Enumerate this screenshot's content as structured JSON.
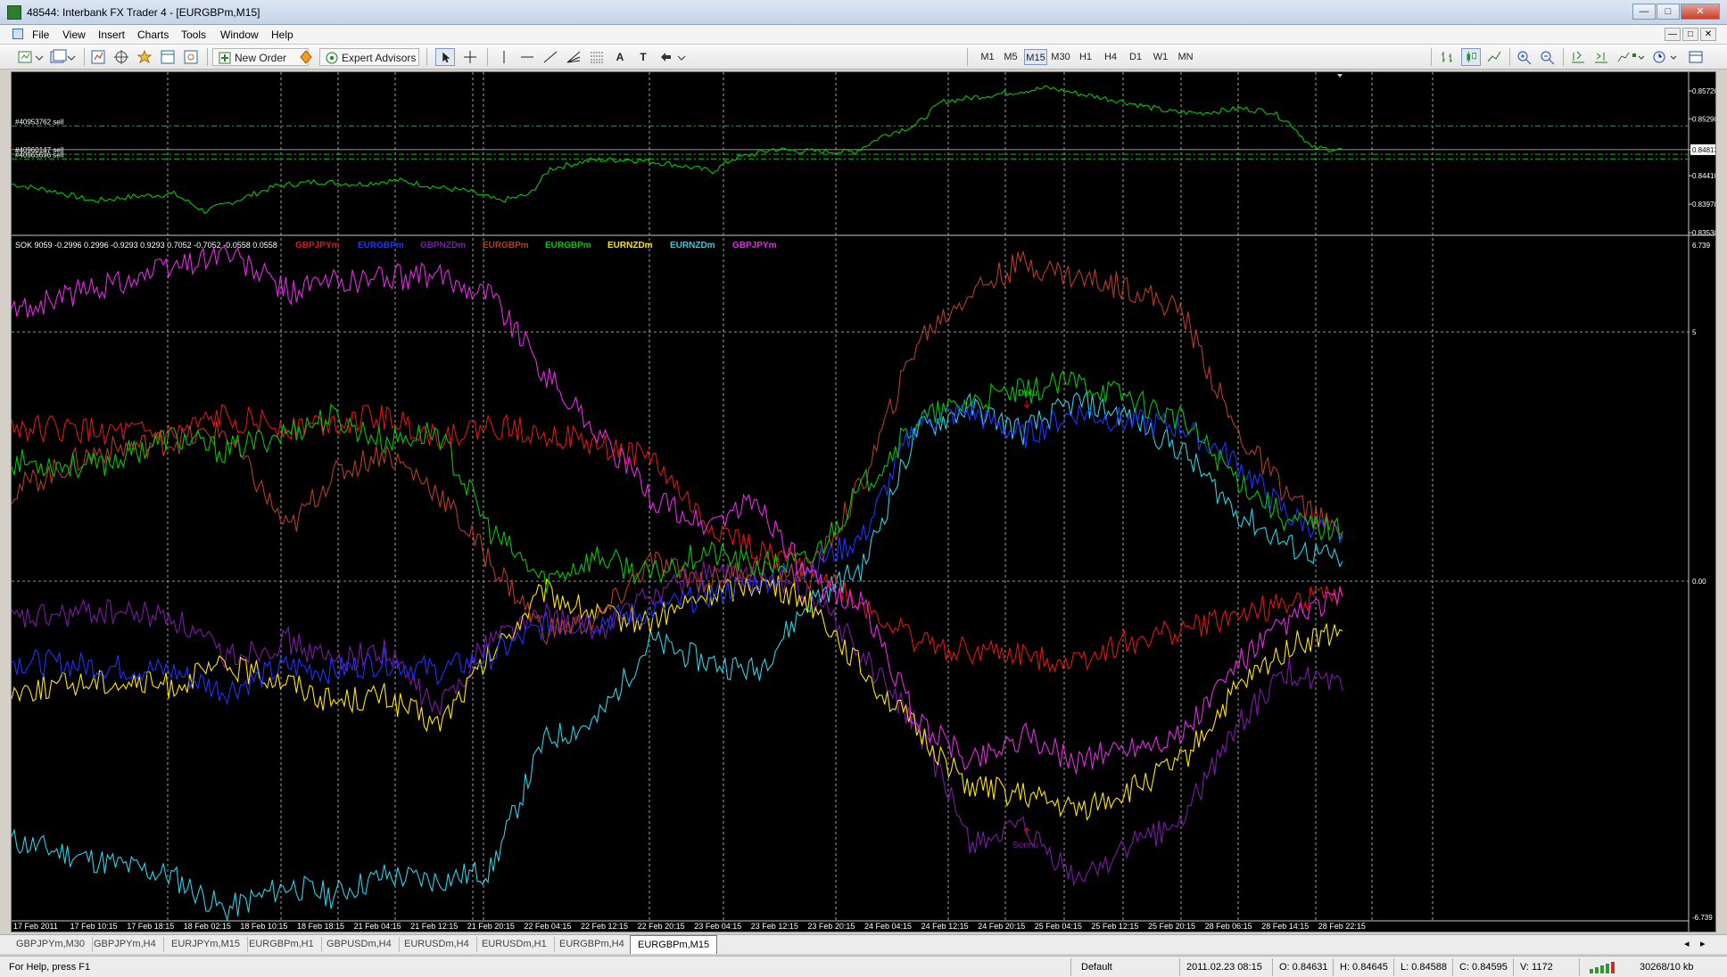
{
  "window": {
    "title": "48544: Interbank FX Trader 4 - [EURGBPm,M15]",
    "min_label": "—",
    "max_label": "□",
    "close_label": "✕"
  },
  "menu": {
    "items": [
      "File",
      "View",
      "Insert",
      "Charts",
      "Tools",
      "Window",
      "Help"
    ]
  },
  "toolbar": {
    "new_order_label": "New Order",
    "expert_advisors_label": "Expert Advisors",
    "timeframes": [
      "M1",
      "M5",
      "M15",
      "M30",
      "H1",
      "H4",
      "D1",
      "W1",
      "MN"
    ],
    "active_timeframe": "M15",
    "text_tool_label": "A",
    "label_tool_label": "T"
  },
  "colors": {
    "price_line": "#00c800",
    "grid": "#c8c8c8",
    "GBPJPYm": "#e01414",
    "EURGBPm_blue": "#1e32ff",
    "GBPNZDm": "#7d18a8",
    "EURGBPm_dark": "#b43c28",
    "EURGBPm_green": "#00c800",
    "EURNZDm": "#ffe600",
    "EURNZDm_cyan": "#28d2e6",
    "GBPJPYm_magenta": "#e628e6"
  },
  "price_panel": {
    "price_axis": [
      "0.85720",
      "0.85290",
      "0.84813",
      "0.84410",
      "0.83970",
      "0.83530"
    ],
    "current_price": "0.84813",
    "orders": [
      {
        "label": "#40953762 sell",
        "price": 0.8518
      },
      {
        "label": "#40960147 sell",
        "price": 0.8474
      },
      {
        "label": "#40965696 sell",
        "price": 0.8467
      }
    ]
  },
  "indicator_panel": {
    "header": "SOK 9059 -0.2996 0.2996 -0.9293 0.9293 0.7052 -0.7052 -0.0558 0.0558",
    "legend": [
      {
        "name": "GBPJPYm",
        "color": "#e01414"
      },
      {
        "name": "EURGBPm",
        "color": "#1e32ff"
      },
      {
        "name": "GBPNZDm",
        "color": "#7d18a8"
      },
      {
        "name": "EURGBPm",
        "color": "#b43c28"
      },
      {
        "name": "EURGBPm",
        "color": "#00c800"
      },
      {
        "name": "EURNZDm",
        "color": "#ffe600"
      },
      {
        "name": "EURNZDm",
        "color": "#28d2e6"
      },
      {
        "name": "GBPJPYm",
        "color": "#e628e6"
      }
    ],
    "axis_top": "6.739",
    "axis_five": "5",
    "axis_zero": "0.00",
    "axis_bottom": "-6.739",
    "label_top": "Dolu",
    "label_bottom": "Sonnu"
  },
  "time_axis": [
    "17 Feb 2011",
    "17 Feb 10:15",
    "17 Feb 18:15",
    "18 Feb 02:15",
    "18 Feb 10:15",
    "18 Feb 18:15",
    "21 Feb 04:15",
    "21 Feb 12:15",
    "21 Feb 20:15",
    "22 Feb 04:15",
    "22 Feb 12:15",
    "22 Feb 20:15",
    "23 Feb 04:15",
    "23 Feb 12:15",
    "23 Feb 20:15",
    "24 Feb 04:15",
    "24 Feb 12:15",
    "24 Feb 20:15",
    "25 Feb 04:15",
    "25 Feb 12:15",
    "25 Feb 20:15",
    "28 Feb 06:15",
    "28 Feb 14:15",
    "28 Feb 22:15"
  ],
  "tabs": [
    "GBPJPYm,M30",
    "GBPJPYm,H4",
    "EURJPYm,M15",
    "EURGBPm,H1",
    "GBPUSDm,H4",
    "EURUSDm,H4",
    "EURUSDm,H1",
    "EURGBPm,H4",
    "EURGBPm,M15"
  ],
  "active_tab": "EURGBPm,M15",
  "status": {
    "help": "For Help, press F1",
    "profile": "Default",
    "datetime": "2011.02.23 08:15",
    "open": "O: 0.84631",
    "high": "H: 0.84645",
    "low": "L: 0.84588",
    "close": "C: 0.84595",
    "volume": "V: 1172",
    "traffic": "30268/10 kb"
  },
  "series_paths": {
    "price": [
      [
        0,
        0.8428
      ],
      [
        0.04,
        0.8418
      ],
      [
        0.08,
        0.8402
      ],
      [
        0.12,
        0.8409
      ],
      [
        0.16,
        0.8413
      ],
      [
        0.19,
        0.8386
      ],
      [
        0.22,
        0.8402
      ],
      [
        0.26,
        0.8425
      ],
      [
        0.3,
        0.8432
      ],
      [
        0.34,
        0.8428
      ],
      [
        0.38,
        0.8434
      ],
      [
        0.42,
        0.8423
      ],
      [
        0.45,
        0.8417
      ],
      [
        0.48,
        0.8402
      ],
      [
        0.51,
        0.8412
      ],
      [
        0.53,
        0.8452
      ],
      [
        0.57,
        0.8465
      ],
      [
        0.61,
        0.8466
      ],
      [
        0.65,
        0.8459
      ],
      [
        0.69,
        0.8448
      ],
      [
        0.71,
        0.8467
      ],
      [
        0.75,
        0.8482
      ],
      [
        0.78,
        0.8479
      ],
      [
        0.83,
        0.8478
      ],
      [
        0.86,
        0.8505
      ],
      [
        0.89,
        0.8519
      ],
      [
        0.915,
        0.8555
      ],
      [
        0.95,
        0.8563
      ],
      [
        0.98,
        0.8569
      ],
      [
        1.02,
        0.8577
      ],
      [
        1.05,
        0.8568
      ],
      [
        1.09,
        0.8557
      ],
      [
        1.14,
        0.854
      ],
      [
        1.17,
        0.8538
      ],
      [
        1.21,
        0.8545
      ],
      [
        1.24,
        0.854
      ],
      [
        1.26,
        0.852
      ],
      [
        1.28,
        0.8484
      ],
      [
        1.31,
        0.8481
      ]
    ],
    "GBPJPYm": [
      [
        0,
        3.1
      ],
      [
        0.08,
        3.0
      ],
      [
        0.15,
        2.9
      ],
      [
        0.2,
        3.3
      ],
      [
        0.26,
        3.1
      ],
      [
        0.3,
        3.2
      ],
      [
        0.35,
        3.3
      ],
      [
        0.4,
        2.9
      ],
      [
        0.45,
        3.1
      ],
      [
        0.5,
        3.0
      ],
      [
        0.55,
        2.7
      ],
      [
        0.6,
        2.5
      ],
      [
        0.65,
        1.2
      ],
      [
        0.7,
        0.6
      ],
      [
        0.75,
        0.3
      ],
      [
        0.8,
        -0.5
      ],
      [
        0.85,
        -1.2
      ],
      [
        0.9,
        -1.4
      ],
      [
        0.95,
        -1.5
      ],
      [
        1.0,
        -1.6
      ],
      [
        1.05,
        -1.2
      ],
      [
        1.1,
        -1.0
      ],
      [
        1.15,
        -0.7
      ],
      [
        1.2,
        -0.4
      ],
      [
        1.25,
        -0.3
      ]
    ],
    "EURGBPm_blue": [
      [
        0,
        -1.6
      ],
      [
        0.08,
        -1.7
      ],
      [
        0.15,
        -1.8
      ],
      [
        0.2,
        -2.2
      ],
      [
        0.26,
        -1.7
      ],
      [
        0.3,
        -1.8
      ],
      [
        0.35,
        -1.6
      ],
      [
        0.4,
        -1.8
      ],
      [
        0.45,
        -1.5
      ],
      [
        0.5,
        -0.9
      ],
      [
        0.55,
        -0.8
      ],
      [
        0.6,
        -0.6
      ],
      [
        0.65,
        -0.3
      ],
      [
        0.7,
        0.0
      ],
      [
        0.75,
        0.3
      ],
      [
        0.8,
        0.9
      ],
      [
        0.85,
        3.2
      ],
      [
        0.9,
        3.4
      ],
      [
        0.95,
        2.9
      ],
      [
        1.0,
        3.4
      ],
      [
        1.05,
        3.2
      ],
      [
        1.1,
        3.1
      ],
      [
        1.15,
        2.4
      ],
      [
        1.2,
        1.3
      ],
      [
        1.25,
        0.9
      ]
    ],
    "GBPNZDm": [
      [
        0,
        -0.8
      ],
      [
        0.08,
        -0.6
      ],
      [
        0.15,
        -0.7
      ],
      [
        0.2,
        -1.5
      ],
      [
        0.26,
        -1.2
      ],
      [
        0.3,
        -1.6
      ],
      [
        0.35,
        -1.4
      ],
      [
        0.4,
        -2.6
      ],
      [
        0.45,
        -1.1
      ],
      [
        0.5,
        -0.7
      ],
      [
        0.55,
        -1.0
      ],
      [
        0.6,
        -0.3
      ],
      [
        0.65,
        0.2
      ],
      [
        0.7,
        0.0
      ],
      [
        0.75,
        -0.2
      ],
      [
        0.8,
        -1.5
      ],
      [
        0.85,
        -2.9
      ],
      [
        0.9,
        -5.2
      ],
      [
        0.95,
        -5.0
      ],
      [
        1.0,
        -6.0
      ],
      [
        1.05,
        -5.3
      ],
      [
        1.1,
        -4.8
      ],
      [
        1.15,
        -2.9
      ],
      [
        1.2,
        -1.8
      ],
      [
        1.25,
        -2.2
      ]
    ],
    "EURGBPm_dark": [
      [
        0,
        1.8
      ],
      [
        0.08,
        2.6
      ],
      [
        0.15,
        2.8
      ],
      [
        0.2,
        3.0
      ],
      [
        0.26,
        1.0
      ],
      [
        0.3,
        2.1
      ],
      [
        0.35,
        2.6
      ],
      [
        0.4,
        1.8
      ],
      [
        0.45,
        0.4
      ],
      [
        0.5,
        -1.0
      ],
      [
        0.55,
        -0.8
      ],
      [
        0.6,
        0.4
      ],
      [
        0.65,
        0.0
      ],
      [
        0.7,
        0.3
      ],
      [
        0.75,
        0.1
      ],
      [
        0.8,
        2.0
      ],
      [
        0.85,
        4.8
      ],
      [
        0.9,
        5.8
      ],
      [
        0.95,
        6.4
      ],
      [
        1.0,
        6.1
      ],
      [
        1.05,
        5.9
      ],
      [
        1.1,
        5.4
      ],
      [
        1.15,
        3.0
      ],
      [
        1.2,
        1.7
      ],
      [
        1.25,
        0.9
      ]
    ],
    "EURGBPm_green": [
      [
        0,
        2.4
      ],
      [
        0.08,
        2.3
      ],
      [
        0.15,
        2.9
      ],
      [
        0.2,
        2.6
      ],
      [
        0.26,
        3.0
      ],
      [
        0.3,
        3.3
      ],
      [
        0.35,
        2.8
      ],
      [
        0.4,
        3.0
      ],
      [
        0.45,
        1.0
      ],
      [
        0.5,
        0.0
      ],
      [
        0.55,
        0.5
      ],
      [
        0.6,
        0.1
      ],
      [
        0.65,
        0.6
      ],
      [
        0.7,
        0.3
      ],
      [
        0.75,
        0.4
      ],
      [
        0.8,
        1.9
      ],
      [
        0.85,
        3.2
      ],
      [
        0.9,
        3.6
      ],
      [
        0.95,
        3.8
      ],
      [
        1.0,
        4.0
      ],
      [
        1.05,
        3.7
      ],
      [
        1.1,
        3.2
      ],
      [
        1.15,
        2.1
      ],
      [
        1.2,
        1.2
      ],
      [
        1.25,
        1.0
      ]
    ],
    "EURNZDm": [
      [
        0,
        -2.2
      ],
      [
        0.08,
        -2.0
      ],
      [
        0.15,
        -2.1
      ],
      [
        0.2,
        -1.7
      ],
      [
        0.26,
        -2.0
      ],
      [
        0.3,
        -2.4
      ],
      [
        0.35,
        -2.3
      ],
      [
        0.4,
        -2.9
      ],
      [
        0.45,
        -1.5
      ],
      [
        0.5,
        -0.2
      ],
      [
        0.55,
        -0.7
      ],
      [
        0.6,
        -0.8
      ],
      [
        0.65,
        -0.3
      ],
      [
        0.7,
        0.0
      ],
      [
        0.75,
        -0.4
      ],
      [
        0.8,
        -1.8
      ],
      [
        0.85,
        -3.0
      ],
      [
        0.9,
        -4.1
      ],
      [
        0.95,
        -4.3
      ],
      [
        1.0,
        -4.6
      ],
      [
        1.05,
        -4.2
      ],
      [
        1.1,
        -3.6
      ],
      [
        1.15,
        -2.2
      ],
      [
        1.2,
        -1.3
      ],
      [
        1.25,
        -1.0
      ]
    ],
    "EURNZDm_cyan": [
      [
        0,
        -5.2
      ],
      [
        0.08,
        -5.6
      ],
      [
        0.15,
        -5.9
      ],
      [
        0.2,
        -6.6
      ],
      [
        0.26,
        -6.1
      ],
      [
        0.3,
        -6.3
      ],
      [
        0.35,
        -5.9
      ],
      [
        0.4,
        -6.0
      ],
      [
        0.45,
        -5.8
      ],
      [
        0.5,
        -3.2
      ],
      [
        0.55,
        -2.8
      ],
      [
        0.6,
        -1.2
      ],
      [
        0.65,
        -1.6
      ],
      [
        0.7,
        -1.8
      ],
      [
        0.75,
        -0.4
      ],
      [
        0.8,
        0.3
      ],
      [
        0.85,
        3.0
      ],
      [
        0.9,
        3.5
      ],
      [
        0.95,
        3.0
      ],
      [
        1.0,
        3.6
      ],
      [
        1.05,
        3.3
      ],
      [
        1.1,
        2.6
      ],
      [
        1.15,
        1.4
      ],
      [
        1.2,
        0.7
      ],
      [
        1.25,
        0.4
      ]
    ],
    "GBPJPYm_magenta": [
      [
        0,
        5.4
      ],
      [
        0.08,
        5.9
      ],
      [
        0.15,
        6.3
      ],
      [
        0.2,
        6.6
      ],
      [
        0.26,
        5.8
      ],
      [
        0.3,
        6.0
      ],
      [
        0.35,
        6.1
      ],
      [
        0.4,
        6.1
      ],
      [
        0.45,
        5.8
      ],
      [
        0.5,
        4.2
      ],
      [
        0.55,
        3.0
      ],
      [
        0.6,
        1.7
      ],
      [
        0.65,
        1.1
      ],
      [
        0.7,
        1.6
      ],
      [
        0.75,
        0.0
      ],
      [
        0.8,
        -0.5
      ],
      [
        0.85,
        -2.8
      ],
      [
        0.9,
        -3.6
      ],
      [
        0.95,
        -3.1
      ],
      [
        1.0,
        -3.6
      ],
      [
        1.05,
        -3.3
      ],
      [
        1.1,
        -3.1
      ],
      [
        1.15,
        -1.7
      ],
      [
        1.2,
        -0.8
      ],
      [
        1.25,
        -0.3
      ]
    ]
  }
}
